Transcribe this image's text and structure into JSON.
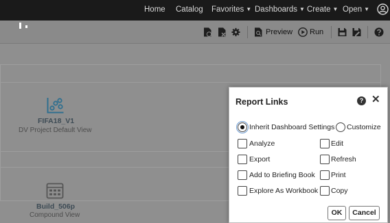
{
  "nav": {
    "items": [
      {
        "label": "Home"
      },
      {
        "label": "Catalog"
      },
      {
        "label": "Favorites"
      },
      {
        "label": "Dashboards"
      },
      {
        "label": "Create"
      },
      {
        "label": "Open"
      }
    ]
  },
  "toolbar": {
    "preview_label": "Preview",
    "run_label": "Run"
  },
  "canvas": {
    "views": [
      {
        "title": "FIFA18_V1",
        "subtitle": "DV Project Default View"
      },
      {
        "title": "Build_506p",
        "subtitle": "Compound View"
      }
    ]
  },
  "dialog": {
    "title": "Report Links",
    "inherit_label": "Inherit Dashboard Settings",
    "customize_label": "Customize",
    "options": [
      {
        "label": "Analyze"
      },
      {
        "label": "Edit"
      },
      {
        "label": "Export"
      },
      {
        "label": "Refresh"
      },
      {
        "label": "Add to Briefing Book"
      },
      {
        "label": "Print"
      },
      {
        "label": "Explore As Workbook"
      },
      {
        "label": "Copy"
      }
    ],
    "ok_label": "OK",
    "cancel_label": "Cancel"
  },
  "icons": {
    "help": "help-icon",
    "close": "close-icon",
    "user": "user-icon"
  },
  "colors": {
    "topbar_bg": "#1a1a1a",
    "overlay_bg": "#8f8f8f",
    "view_icon": "#2f6f8f"
  }
}
